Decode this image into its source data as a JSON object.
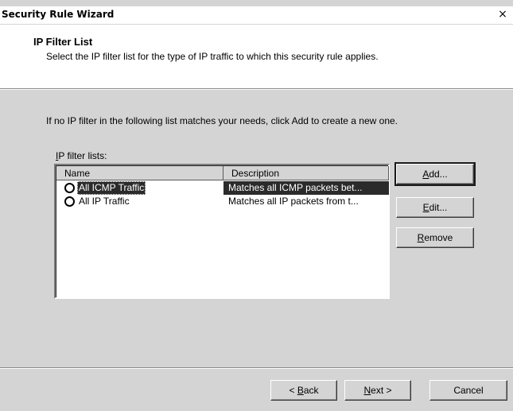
{
  "window": {
    "title": "Security Rule Wizard",
    "close_glyph": "×"
  },
  "header": {
    "title": "IP Filter List",
    "subtitle": "Select the IP filter list for the type of IP traffic to which this security rule applies."
  },
  "body": {
    "info": "If no IP filter in the following list matches your needs, click Add to create a new one.",
    "list_label_accel": "I",
    "list_label_rest": "P filter lists:"
  },
  "list": {
    "columns": [
      "Name",
      "Description"
    ],
    "rows": [
      {
        "name": "All ICMP Traffic",
        "description": "Matches all ICMP packets bet..."
      },
      {
        "name": "All IP Traffic",
        "description": "Matches all IP packets from t..."
      }
    ]
  },
  "side_buttons": {
    "add_accel": "A",
    "add_rest": "dd...",
    "edit_accel": "E",
    "edit_rest": "dit...",
    "remove_accel": "R",
    "remove_rest": "emove"
  },
  "footer": {
    "back_pre": "< ",
    "back_accel": "B",
    "back_rest": "ack",
    "next_accel": "N",
    "next_rest": "ext >",
    "cancel": "Cancel"
  }
}
